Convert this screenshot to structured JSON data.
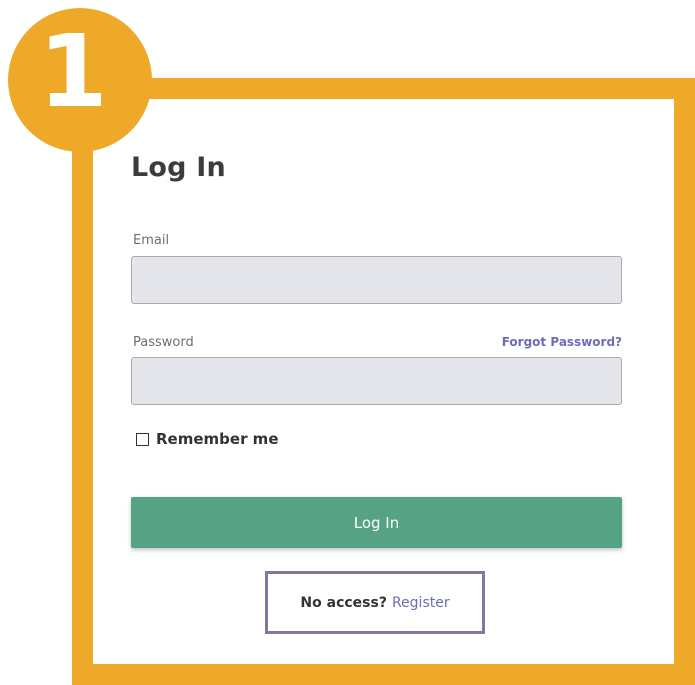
{
  "step": {
    "number": "1"
  },
  "form": {
    "title": "Log In",
    "email": {
      "label": "Email",
      "value": "",
      "placeholder": ""
    },
    "password": {
      "label": "Password",
      "value": "",
      "placeholder": ""
    },
    "forgot_password": "Forgot Password?",
    "remember_me": {
      "label": "Remember me",
      "checked": false
    },
    "submit_label": "Log In",
    "no_access_text": "No access?",
    "register_link": "Register"
  },
  "colors": {
    "accent": "#EEA928",
    "primary": "#55A284",
    "link": "#6C6DB5",
    "highlight": "#7B7AA5",
    "input_bg": "#E5E6EC"
  }
}
